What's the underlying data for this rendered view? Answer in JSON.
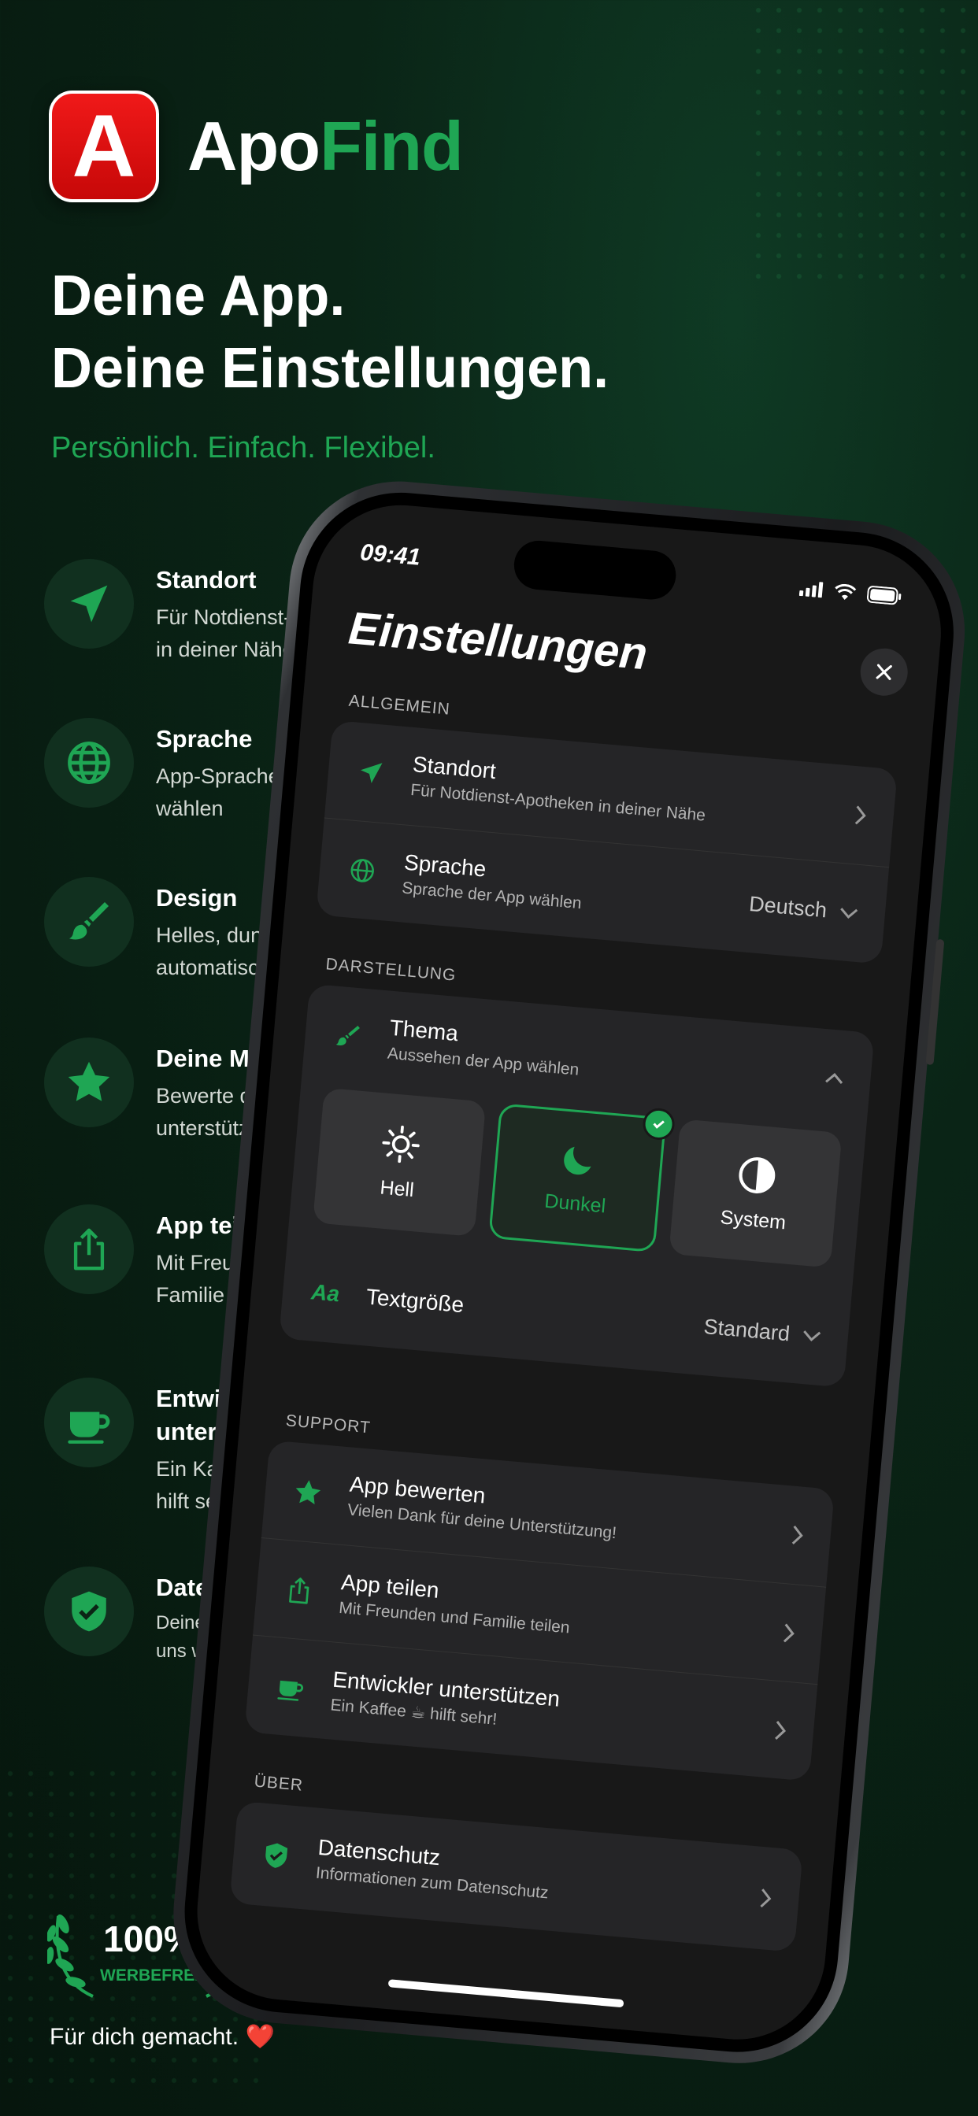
{
  "brand": {
    "logo_letter": "A",
    "name_part1": "Apo",
    "name_part2": "Find",
    "accent": "#1fa654",
    "logo_red": "#e31414"
  },
  "headline": {
    "line1": "Deine App.",
    "line2": "Deine Einstellungen."
  },
  "tagline": "Persönlich. Einfach. Flexibel.",
  "features": [
    {
      "title": "Standort",
      "sub1": "Für Notdienst-Apotheken",
      "sub2": "in deiner Nähe",
      "icon": "location-arrow-icon"
    },
    {
      "title": "Sprache",
      "sub1": "App-Sprache",
      "sub2": "wählen",
      "icon": "globe-icon"
    },
    {
      "title": "Design",
      "sub1": "Helles, dunkles oder",
      "sub2": "automatisches Design",
      "icon": "paintbrush-icon"
    },
    {
      "title": "Deine Meinung",
      "sub1": "Bewerte die App und",
      "sub2": "unterstütze uns",
      "icon": "star-icon"
    },
    {
      "title": "App teilen",
      "sub1": "Mit Freunden und",
      "sub2": "Familie teilen",
      "icon": "share-icon"
    },
    {
      "title1": "Entwickler",
      "title2": "unterstützen",
      "sub1": "Ein Kaffee ☕",
      "sub2": "hilft sehr!",
      "icon": "coffee-icon"
    },
    {
      "title": "Datenschutz",
      "sub1": "Deine Daten sind",
      "sub2": "uns wichtig",
      "icon": "shield-check-icon"
    }
  ],
  "badge": {
    "value": "100%",
    "label": "WERBEFREI"
  },
  "footer": {
    "text": "Für dich gemacht.",
    "heart": "❤️"
  },
  "phone": {
    "status_time": "09:41",
    "title": "Einstellungen",
    "sections": {
      "general": "ALLGEMEIN",
      "appearance": "DARSTELLUNG",
      "support": "SUPPORT",
      "about": "ÜBER"
    },
    "general": [
      {
        "title": "Standort",
        "sub": "Für Notdienst-Apotheken in deiner Nähe"
      },
      {
        "title": "Sprache",
        "sub": "Sprache der App wählen",
        "value": "Deutsch"
      }
    ],
    "theme": {
      "title": "Thema",
      "sub": "Aussehen der App wählen",
      "options": [
        "Hell",
        "Dunkel",
        "System"
      ],
      "selected": "Dunkel"
    },
    "textsize": {
      "icon_text": "Aa",
      "title": "Textgröße",
      "value": "Standard"
    },
    "support": [
      {
        "title": "App bewerten",
        "sub": "Vielen Dank für deine Unterstützung!"
      },
      {
        "title": "App teilen",
        "sub": "Mit Freunden und Familie teilen"
      },
      {
        "title": "Entwickler unterstützen",
        "sub": "Ein Kaffee ☕ hilft sehr!"
      }
    ],
    "about": [
      {
        "title": "Datenschutz",
        "sub": "Informationen zum Datenschutz"
      }
    ]
  }
}
